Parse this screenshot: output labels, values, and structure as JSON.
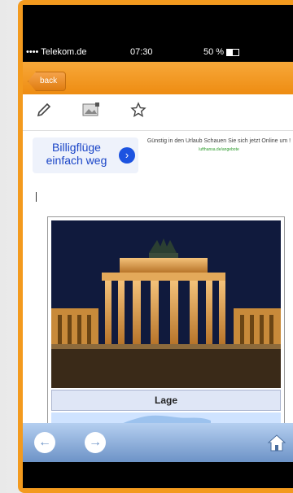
{
  "status_bar": {
    "carrier": "•••• Telekom.de ",
    "time": "07:30",
    "battery": "50 %"
  },
  "nav": {
    "back_label": "back"
  },
  "ad": {
    "title": "Billigflüge einfach weg",
    "text": "Günstig in den Urlaub Schauen Sie sich jetzt Online um !",
    "source": "lufthansa.de/angebote"
  },
  "content": {
    "caption": "Lage"
  },
  "icons": {
    "edit": "pencil-icon",
    "image": "image-icon",
    "favorite": "star-icon",
    "back": "arrow-left-icon",
    "forward": "arrow-right-icon",
    "home": "home-icon"
  },
  "colors": {
    "accent": "#f39a1e",
    "bottom_bar": "#6d93c7"
  }
}
